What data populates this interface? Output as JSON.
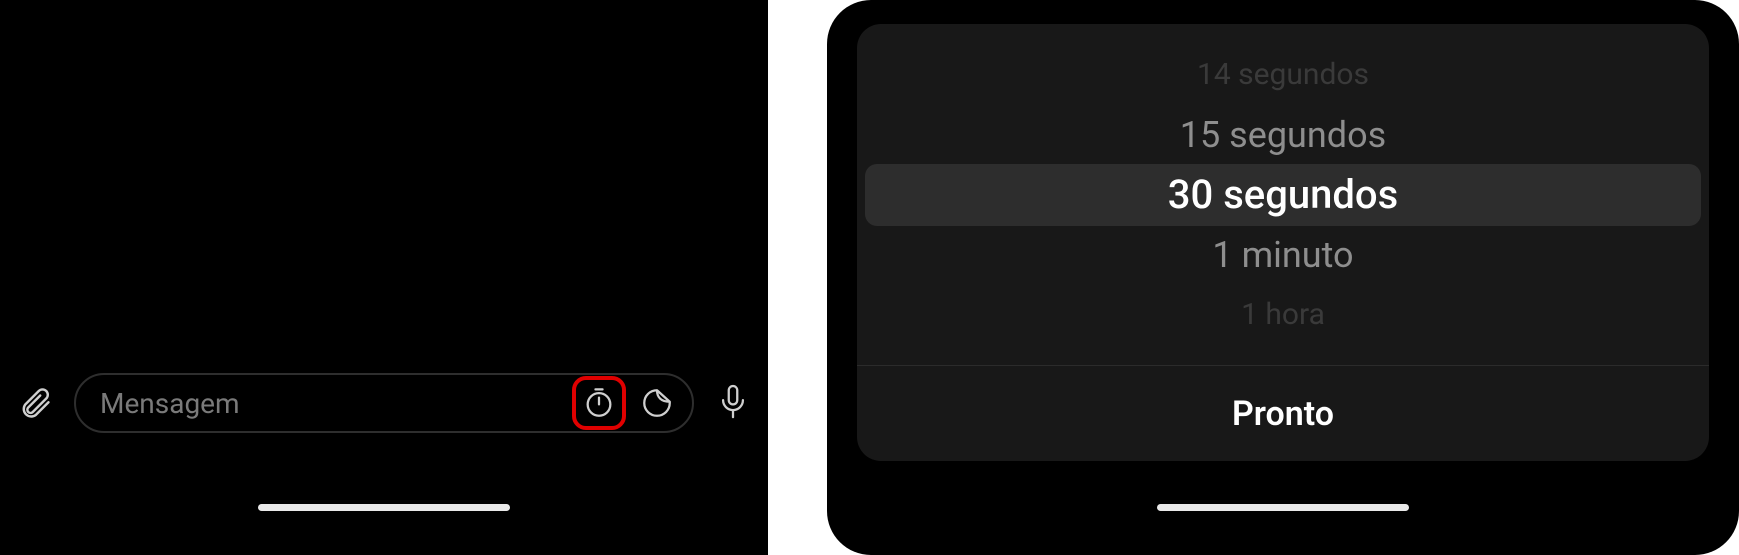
{
  "left": {
    "message_placeholder": "Mensagem",
    "icons": {
      "attach": "paperclip-icon",
      "timer": "timer-icon",
      "sticker": "sticker-icon",
      "mic": "mic-icon"
    }
  },
  "picker": {
    "options": [
      {
        "label": "14 segundos",
        "state": "faded"
      },
      {
        "label": "15 segundos",
        "state": "near"
      },
      {
        "label": "30 segundos",
        "state": "selected"
      },
      {
        "label": "1 minuto",
        "state": "near"
      },
      {
        "label": "1 hora",
        "state": "faded"
      }
    ],
    "done_label": "Pronto"
  },
  "colors": {
    "highlight_border": "#e00000",
    "sheet_bg": "#181818",
    "selection_bg": "#2d2d2d"
  }
}
